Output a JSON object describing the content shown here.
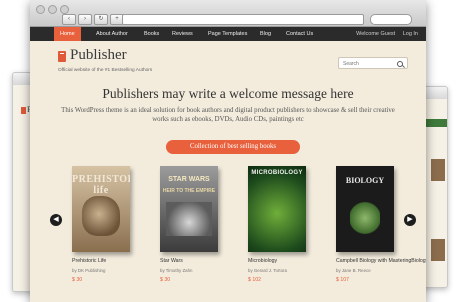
{
  "nav": {
    "items": [
      "Home",
      "About Author",
      "Books",
      "Reviews",
      "Page Templates",
      "Blog",
      "Contact Us"
    ],
    "welcome": "Welcome Guest",
    "login": "Log In"
  },
  "header": {
    "title": "Publisher",
    "tagline": "Official website of the #1 Bestselling Authors",
    "search_placeholder": "Search"
  },
  "headline": "Publishers may write a welcome message here",
  "intro": "This WordPress theme is an ideal solution for book authors and digital product publishers to showcase & sell their creative works such as ebooks, DVDs, Audio CDs, paintings etc",
  "cta_label": "Collection of best selling books",
  "books": [
    {
      "title": "Prehistoric Life",
      "author": "by DK Publishing",
      "price": "$ 30",
      "cover_text": "PREHISTORIC life"
    },
    {
      "title": "Star Wars",
      "author": "by Timothy Zahn",
      "price": "$ 30",
      "cover_text": "STAR WARS",
      "cover_sub": "HEIR TO THE EMPIRE"
    },
    {
      "title": "Microbiology",
      "author": "by Gerard J. Tortora",
      "price": "$ 102",
      "cover_text": "MICROBIOLOGY"
    },
    {
      "title": "Campbell Biology with MasteringBiology",
      "author": "by Jane B. Reece",
      "price": "$ 107",
      "cover_text": "BIOLOGY"
    }
  ],
  "background_windows": {
    "left_logo": "Pu"
  },
  "colors": {
    "accent": "#e8603c",
    "nav_bg": "#2b2b2b",
    "page_bg": "#f3ecdd"
  }
}
